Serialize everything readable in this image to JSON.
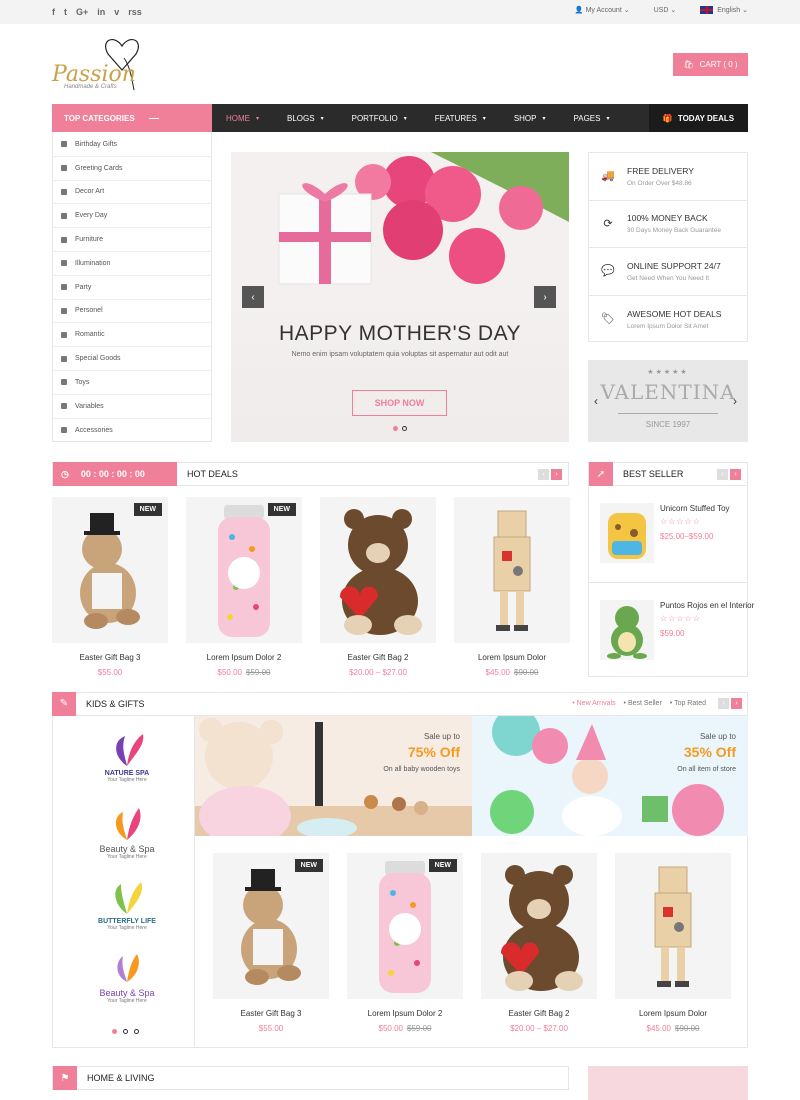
{
  "topbar": {
    "social_icons": [
      "f",
      "t",
      "G+",
      "in",
      "v",
      "rss"
    ],
    "account": "My Account",
    "currency": "USD",
    "language": "English"
  },
  "logo": {
    "text": "Passion",
    "tagline": "Handmade & Crafts"
  },
  "cart": {
    "label": "CART ( 0 )"
  },
  "categories": {
    "title": "TOP CATEGORIES",
    "items": [
      "Birthday Gifts",
      "Greeting Cards",
      "Decor Art",
      "Every Day",
      "Furniture",
      "Illumination",
      "Party",
      "Personel",
      "Romantic",
      "Special Goods",
      "Toys",
      "Variables",
      "Accessories"
    ]
  },
  "nav": {
    "items": [
      "HOME",
      "BLOGS",
      "PORTFOLIO",
      "FEATURES",
      "SHOP",
      "PAGES"
    ],
    "today_deals": "TODAY DEALS"
  },
  "slider": {
    "title": "HAPPY MOTHER'S DAY",
    "subtitle": "Nemo enim ipsam voluptatem quia voluptas sit aspernatur aut odit aut",
    "button": "SHOP NOW"
  },
  "features": [
    {
      "title": "FREE DELIVERY",
      "sub": "On Order Over $48.86"
    },
    {
      "title": "100% MONEY BACK",
      "sub": "30 Days Money Back Guarantee"
    },
    {
      "title": "ONLINE SUPPORT 24/7",
      "sub": "Get Need When You Need It"
    },
    {
      "title": "AWESOME HOT DEALS",
      "sub": "Lorem Ipsum Dolor Sit Amet"
    }
  ],
  "valentina": {
    "name": "VALENTINA",
    "since": "SINCE 1997"
  },
  "hot_deals": {
    "timer": "00 : 00 : 00 : 00",
    "title": "HOT DEALS",
    "products": [
      {
        "name": "Easter Gift Bag 3",
        "price": "$55.00",
        "old": "",
        "badge": "NEW"
      },
      {
        "name": "Lorem Ipsum Dolor 2",
        "price": "$50.00",
        "old": "$59.00",
        "badge": "NEW"
      },
      {
        "name": "Easter Gift Bag 2",
        "price": "$20.00 – $27.00",
        "old": "",
        "badge": ""
      },
      {
        "name": "Lorem Ipsum Dolor",
        "price": "$45.00",
        "old": "$90.00",
        "badge": ""
      }
    ]
  },
  "best_seller": {
    "title": "BEST SELLER",
    "items": [
      {
        "name": "Unicorn Stuffed Toy",
        "price": "$25.00–$59.00"
      },
      {
        "name": "Puntos Rojos en el Interior",
        "price": "$59.00"
      }
    ]
  },
  "kids": {
    "title": "KIDS & GIFTS",
    "tabs": [
      "New Arrivals",
      "Best Seller",
      "Top Rated"
    ],
    "brands": [
      {
        "name": "NATURE SPA",
        "tag": "Your Tagline Here"
      },
      {
        "name": "Beauty & Spa",
        "tag": "Your Tagline Here"
      },
      {
        "name": "BUTTERFLY LIFE",
        "tag": "Your Tagline Here"
      },
      {
        "name": "Beauty & Spa",
        "tag": "Your Tagline Here"
      }
    ],
    "banners": [
      {
        "line1": "Sale up to",
        "line2": "75% Off",
        "line3": "On all baby wooden toys"
      },
      {
        "line1": "Sale up to",
        "line2": "35% Off",
        "line3": "On all item of store"
      }
    ],
    "products": [
      {
        "name": "Easter Gift Bag 3",
        "price": "$55.00",
        "old": "",
        "badge": "NEW"
      },
      {
        "name": "Lorem Ipsum Dolor 2",
        "price": "$50.00",
        "old": "$59.00",
        "badge": "NEW"
      },
      {
        "name": "Easter Gift Bag 2",
        "price": "$20.00 – $27.00",
        "old": "",
        "badge": ""
      },
      {
        "name": "Lorem Ipsum Dolor",
        "price": "$45.00",
        "old": "$90.00",
        "badge": ""
      }
    ]
  },
  "home_living": {
    "title": "HOME & LIVING"
  },
  "colors": {
    "accent": "#f07f99",
    "dark": "#2b2b2b",
    "orange": "#f59a1f"
  }
}
